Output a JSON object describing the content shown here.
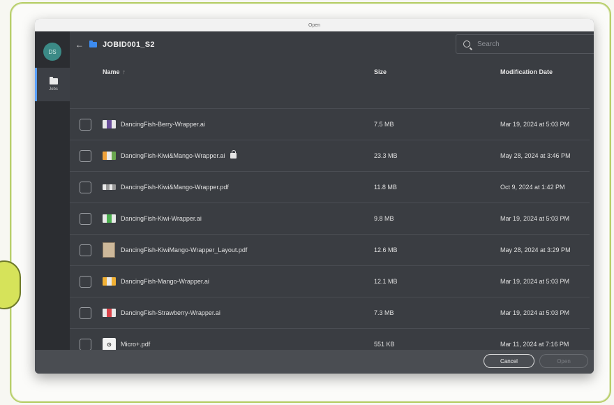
{
  "window": {
    "title": "Open"
  },
  "rail": {
    "avatar_initials": "DS",
    "items": [
      {
        "label": "Jobs",
        "icon": "folder-icon"
      }
    ]
  },
  "nav": {
    "back_icon": "arrow-left-icon",
    "folder_icon": "folder-icon",
    "current_folder": "JOBID001_S2"
  },
  "search": {
    "placeholder": "Search",
    "value": ""
  },
  "table": {
    "columns": {
      "name": "Name",
      "size": "Size",
      "date": "Modification Date"
    },
    "sort_indicator": "↑",
    "more_icon": "⋮",
    "rows": [
      {
        "name": "DancingFish-Berry-Wrapper.ai",
        "size": "7.5 MB",
        "date": "Mar 19, 2024 at 5:03 PM",
        "thumb": "wrapper",
        "locked": false
      },
      {
        "name": "DancingFish-Kiwi&Mango-Wrapper.ai",
        "size": "23.3 MB",
        "date": "May 28, 2024 at 3:46 PM",
        "thumb": "wrapper",
        "locked": true
      },
      {
        "name": "DancingFish-Kiwi&Mango-Wrapper.pdf",
        "size": "11.8 MB",
        "date": "Oct 9, 2024 at 1:42 PM",
        "thumb": "wrapper",
        "locked": false
      },
      {
        "name": "DancingFish-Kiwi-Wrapper.ai",
        "size": "9.8 MB",
        "date": "Mar 19, 2024 at 5:03 PM",
        "thumb": "wrapper",
        "locked": false
      },
      {
        "name": "DancingFish-KiwiMango-Wrapper_Layout.pdf",
        "size": "12.6 MB",
        "date": "May 28, 2024 at 3:29 PM",
        "thumb": "layout",
        "locked": false
      },
      {
        "name": "DancingFish-Mango-Wrapper.ai",
        "size": "12.1 MB",
        "date": "Mar 19, 2024 at 5:03 PM",
        "thumb": "wrapper",
        "locked": false
      },
      {
        "name": "DancingFish-Strawberry-Wrapper.ai",
        "size": "7.3 MB",
        "date": "Mar 19, 2024 at 5:03 PM",
        "thumb": "wrapper",
        "locked": false
      },
      {
        "name": "Micro+.pdf",
        "size": "551 KB",
        "date": "Mar 11, 2024 at 7:16 PM",
        "thumb": "pdf",
        "locked": false
      }
    ]
  },
  "buttons": {
    "cancel": "Cancel",
    "open": "Open"
  },
  "colors": {
    "dialog_bg": "#3a3d42",
    "accent": "#3d8cf0",
    "avatar": "#3b8a86",
    "frame_border": "#b8cf6a"
  }
}
